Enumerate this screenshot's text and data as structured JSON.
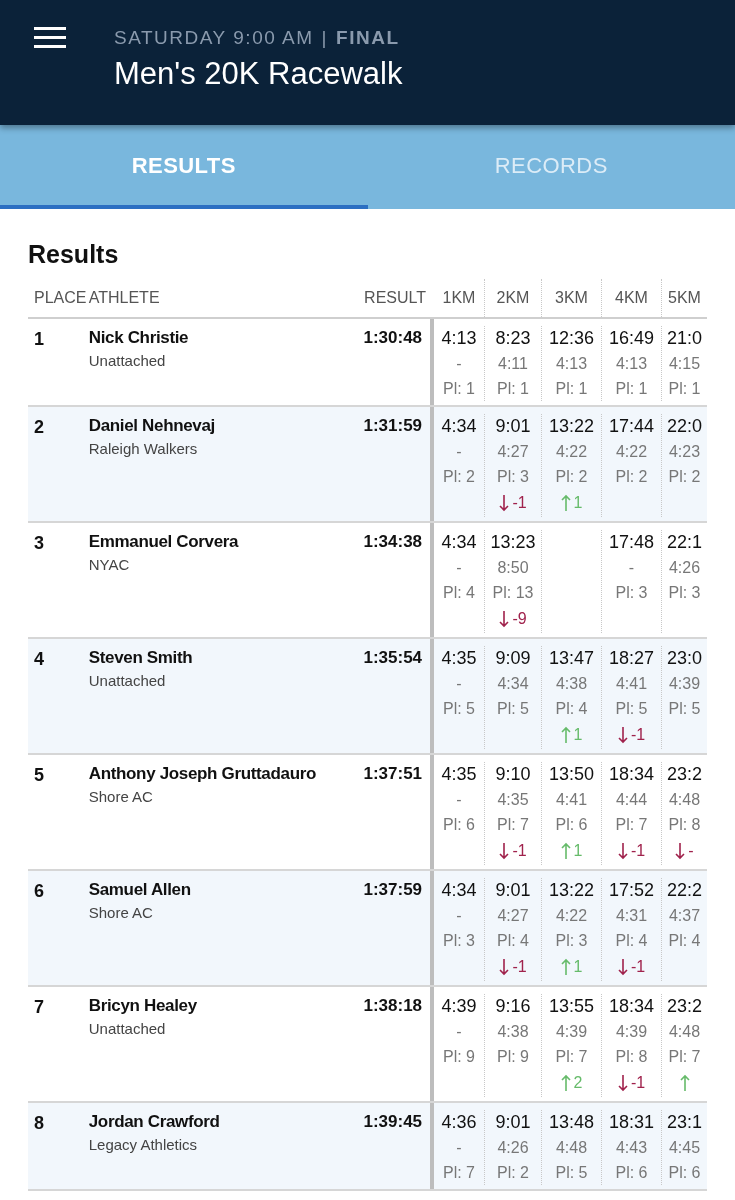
{
  "header": {
    "schedule": "SATURDAY 9:00 AM",
    "separator": "|",
    "status": "FINAL",
    "title": "Men's 20K Racewalk"
  },
  "tabs": [
    {
      "label": "RESULTS",
      "selected": true
    },
    {
      "label": "RECORDS",
      "selected": false
    }
  ],
  "section_title": "Results",
  "table": {
    "columns": {
      "place": "PLACE",
      "athlete": "ATHLETE",
      "result": "RESULT",
      "splits": [
        "1KM",
        "2KM",
        "3KM",
        "4KM",
        "5KM"
      ]
    },
    "rows": [
      {
        "place": "1",
        "name": "Nick Christie",
        "team": "Unattached",
        "result": "1:30:48",
        "splits": [
          {
            "kind": "split",
            "time": "4:13",
            "lap": "-",
            "pl": "Pl: 1"
          },
          {
            "kind": "split",
            "time": "8:23",
            "lap": "4:11",
            "pl": "Pl: 1"
          },
          {
            "kind": "split",
            "time": "12:36",
            "lap": "4:13",
            "pl": "Pl: 1"
          },
          {
            "kind": "split",
            "time": "16:49",
            "lap": "4:13",
            "pl": "Pl: 1"
          },
          {
            "kind": "split",
            "time": "21:0",
            "lap": "4:15",
            "pl": "Pl: 1"
          }
        ]
      },
      {
        "place": "2",
        "name": "Daniel Nehnevaj",
        "team": "Raleigh Walkers",
        "result": "1:31:59",
        "splits": [
          {
            "kind": "split",
            "time": "4:34",
            "lap": "-",
            "pl": "Pl: 2"
          },
          {
            "kind": "split",
            "time": "9:01",
            "lap": "4:27",
            "pl": "Pl: 3",
            "change": {
              "rising": false,
              "text": "-1"
            }
          },
          {
            "kind": "split",
            "time": "13:22",
            "lap": "4:22",
            "pl": "Pl: 2",
            "change": {
              "rising": true,
              "text": "1"
            }
          },
          {
            "kind": "split",
            "time": "17:44",
            "lap": "4:22",
            "pl": "Pl: 2"
          },
          {
            "kind": "split",
            "time": "22:0",
            "lap": "4:23",
            "pl": "Pl: 2"
          }
        ]
      },
      {
        "place": "3",
        "name": "Emmanuel Corvera",
        "team": "NYAC",
        "result": "1:34:38",
        "splits": [
          {
            "kind": "split",
            "time": "4:34",
            "lap": "-",
            "pl": "Pl: 4"
          },
          {
            "kind": "split",
            "time": "13:23",
            "lap": "8:50",
            "pl": "Pl: 13",
            "change": {
              "rising": false,
              "text": "-9"
            }
          },
          {
            "kind": "missing"
          },
          {
            "kind": "split",
            "time": "17:48",
            "lap": "-",
            "pl": "Pl: 3"
          },
          {
            "kind": "split",
            "time": "22:1",
            "lap": "4:26",
            "pl": "Pl: 3"
          }
        ]
      },
      {
        "place": "4",
        "name": "Steven Smith",
        "team": "Unattached",
        "result": "1:35:54",
        "splits": [
          {
            "kind": "split",
            "time": "4:35",
            "lap": "-",
            "pl": "Pl: 5"
          },
          {
            "kind": "split",
            "time": "9:09",
            "lap": "4:34",
            "pl": "Pl: 5"
          },
          {
            "kind": "split",
            "time": "13:47",
            "lap": "4:38",
            "pl": "Pl: 4",
            "change": {
              "rising": true,
              "text": "1"
            }
          },
          {
            "kind": "split",
            "time": "18:27",
            "lap": "4:41",
            "pl": "Pl: 5",
            "change": {
              "rising": false,
              "text": "-1"
            }
          },
          {
            "kind": "split",
            "time": "23:0",
            "lap": "4:39",
            "pl": "Pl: 5"
          }
        ]
      },
      {
        "place": "5",
        "name": "Anthony Joseph Gruttadauro",
        "team": "Shore AC",
        "result": "1:37:51",
        "splits": [
          {
            "kind": "split",
            "time": "4:35",
            "lap": "-",
            "pl": "Pl: 6"
          },
          {
            "kind": "split",
            "time": "9:10",
            "lap": "4:35",
            "pl": "Pl: 7",
            "change": {
              "rising": false,
              "text": "-1"
            }
          },
          {
            "kind": "split",
            "time": "13:50",
            "lap": "4:41",
            "pl": "Pl: 6",
            "change": {
              "rising": true,
              "text": "1"
            }
          },
          {
            "kind": "split",
            "time": "18:34",
            "lap": "4:44",
            "pl": "Pl: 7",
            "change": {
              "rising": false,
              "text": "-1"
            }
          },
          {
            "kind": "split",
            "time": "23:2",
            "lap": "4:48",
            "pl": "Pl: 8",
            "change": {
              "rising": false,
              "text": "-"
            }
          }
        ]
      },
      {
        "place": "6",
        "name": "Samuel Allen",
        "team": "Shore AC",
        "result": "1:37:59",
        "splits": [
          {
            "kind": "split",
            "time": "4:34",
            "lap": "-",
            "pl": "Pl: 3"
          },
          {
            "kind": "split",
            "time": "9:01",
            "lap": "4:27",
            "pl": "Pl: 4",
            "change": {
              "rising": false,
              "text": "-1"
            }
          },
          {
            "kind": "split",
            "time": "13:22",
            "lap": "4:22",
            "pl": "Pl: 3",
            "change": {
              "rising": true,
              "text": "1"
            }
          },
          {
            "kind": "split",
            "time": "17:52",
            "lap": "4:31",
            "pl": "Pl: 4",
            "change": {
              "rising": false,
              "text": "-1"
            }
          },
          {
            "kind": "split",
            "time": "22:2",
            "lap": "4:37",
            "pl": "Pl: 4"
          }
        ]
      },
      {
        "place": "7",
        "name": "Bricyn Healey",
        "team": "Unattached",
        "result": "1:38:18",
        "splits": [
          {
            "kind": "split",
            "time": "4:39",
            "lap": "-",
            "pl": "Pl: 9"
          },
          {
            "kind": "split",
            "time": "9:16",
            "lap": "4:38",
            "pl": "Pl: 9"
          },
          {
            "kind": "split",
            "time": "13:55",
            "lap": "4:39",
            "pl": "Pl: 7",
            "change": {
              "rising": true,
              "text": "2"
            }
          },
          {
            "kind": "split",
            "time": "18:34",
            "lap": "4:39",
            "pl": "Pl: 8",
            "change": {
              "rising": false,
              "text": "-1"
            }
          },
          {
            "kind": "split",
            "time": "23:2",
            "lap": "4:48",
            "pl": "Pl: 7",
            "change": {
              "rising": true
            }
          }
        ]
      },
      {
        "place": "8",
        "name": "Jordan Crawford",
        "team": "Legacy Athletics",
        "result": "1:39:45",
        "splits": [
          {
            "kind": "split",
            "time": "4:36",
            "lap": "-",
            "pl": "Pl: 7"
          },
          {
            "kind": "split",
            "time": "9:01",
            "lap": "4:26",
            "pl": "Pl: 2"
          },
          {
            "kind": "split",
            "time": "13:48",
            "lap": "4:48",
            "pl": "Pl: 5"
          },
          {
            "kind": "split",
            "time": "18:31",
            "lap": "4:43",
            "pl": "Pl: 6"
          },
          {
            "kind": "split",
            "time": "23:1",
            "lap": "4:45",
            "pl": "Pl: 6"
          }
        ]
      }
    ]
  }
}
